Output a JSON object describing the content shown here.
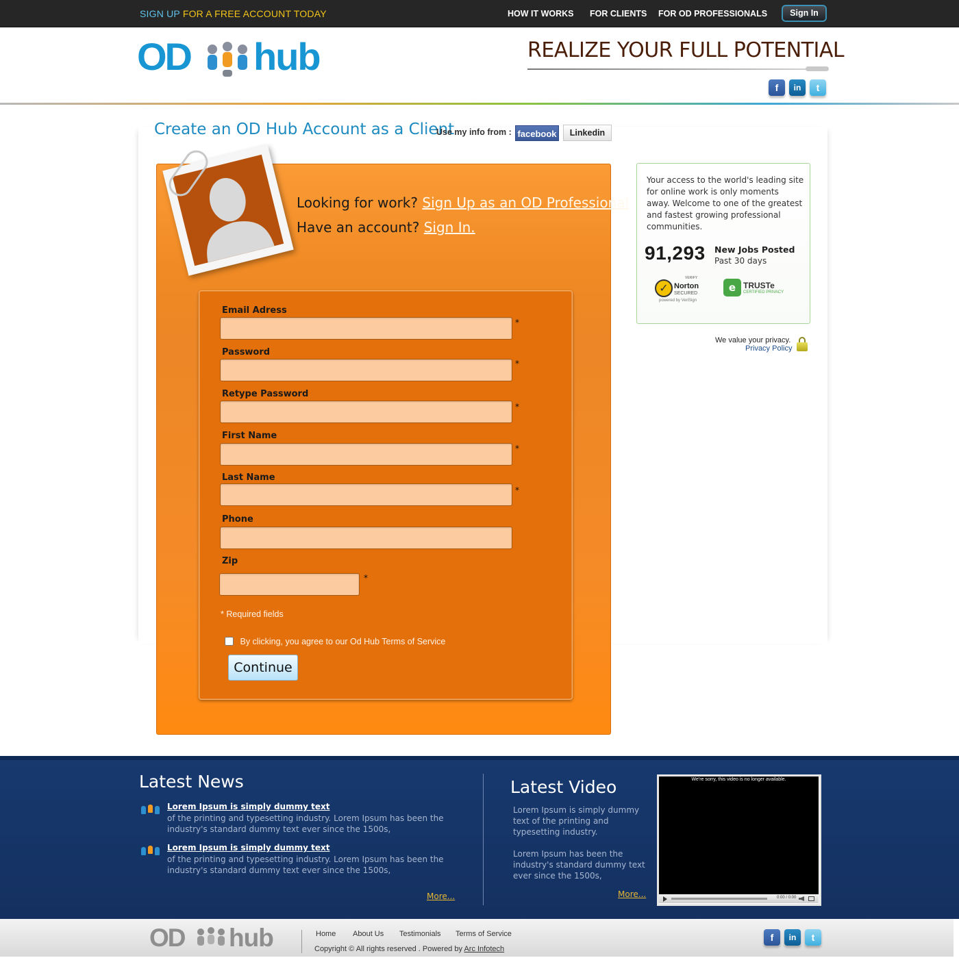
{
  "topbar": {
    "promo_part1": "SIGN UP",
    "promo_part2": "FOR A FREE ACCOUNT TODAY",
    "nav": [
      "HOW IT WORKS",
      "FOR CLIENTS",
      "FOR OD PROFESSIONALS"
    ],
    "signin_label": "Sign In"
  },
  "header": {
    "logo_left": "OD",
    "logo_right": "hub",
    "tagline": "REALIZE YOUR FULL POTENTIAL",
    "social": [
      "facebook-icon",
      "linkedin-icon",
      "twitter-icon"
    ]
  },
  "main": {
    "title": "Create an OD Hub Account as a Client",
    "use_info_label": "Use my info from :",
    "facebook_label": "facebook",
    "linkedin_label": "Linkedin",
    "looking_text": "Looking for work?",
    "signup_pro_link": "Sign Up as an OD Professional",
    "have_account_text": "Have an account?",
    "signin_link": "Sign In.",
    "form": {
      "fields": [
        {
          "label": "Email Adress",
          "value": "",
          "required": "*"
        },
        {
          "label": "Password",
          "value": "",
          "required": "*"
        },
        {
          "label": "Retype Password",
          "value": "",
          "required": "*"
        },
        {
          "label": "First Name",
          "value": "",
          "required": "*"
        },
        {
          "label": "Last Name",
          "value": "",
          "required": "*"
        },
        {
          "label": "Phone",
          "value": "",
          "required": ""
        },
        {
          "label": "Zip",
          "value": "",
          "required": "*"
        }
      ],
      "required_note": "*  Required fields",
      "terms_label": "By clicking, you agree to our Od Hub Terms of Service",
      "terms_checked": false,
      "continue_label": "Continue"
    }
  },
  "sidebar": {
    "intro": "Your access to the world's leading site for online work is only moments away. Welcome to one of the greatest and fastest growing professional communities.",
    "jobs_count": "91,293",
    "jobs_label": "New Jobs Posted",
    "jobs_period": "Past 30 days",
    "norton_verify": "VERIFY",
    "norton_title": "Norton",
    "norton_secured": "SECURED",
    "norton_powered": "powered by VeriSign",
    "truste_title": "TRUSTe",
    "truste_sub": "CERTIFIED PRIVACY",
    "privacy_text": "We value your privacy.",
    "privacy_link": "Privacy Policy"
  },
  "news": {
    "title": "Latest News",
    "items": [
      {
        "title": "Lorem Ipsum is simply dummy text",
        "body": "of the printing and typesetting industry. Lorem Ipsum has been the industry's standard dummy text ever since the 1500s,"
      },
      {
        "title": "Lorem Ipsum is simply dummy text",
        "body": "of the printing and typesetting industry. Lorem Ipsum has been the industry's standard dummy text ever since the 1500s,"
      }
    ],
    "more_label": "More..."
  },
  "video": {
    "title": "Latest Video",
    "text1": "Lorem Ipsum is simply dummy text of the printing and typesetting industry.",
    "text2": "Lorem Ipsum has been the industry's standard dummy text ever since the 1500s,",
    "more_label": "More...",
    "player_message": "We're sorry, this video is no longer available.",
    "player_time": "0:00 / 0:00"
  },
  "footer": {
    "logo_left": "OD",
    "logo_right": "hub",
    "links": [
      "Home",
      "About Us",
      "Testimonials",
      "Terms of Service"
    ],
    "copyright_text": "Copyright ©   All rights reserved . Powered by",
    "powered_link": "Arc Infotech"
  },
  "colors": {
    "topbar_bg": "#262626",
    "accent_blue": "#1d8bc1",
    "panel_orange": "#f08a24",
    "form_orange": "#e4700b",
    "field_fill": "#fdcba0",
    "footer_band": "#17396e"
  }
}
